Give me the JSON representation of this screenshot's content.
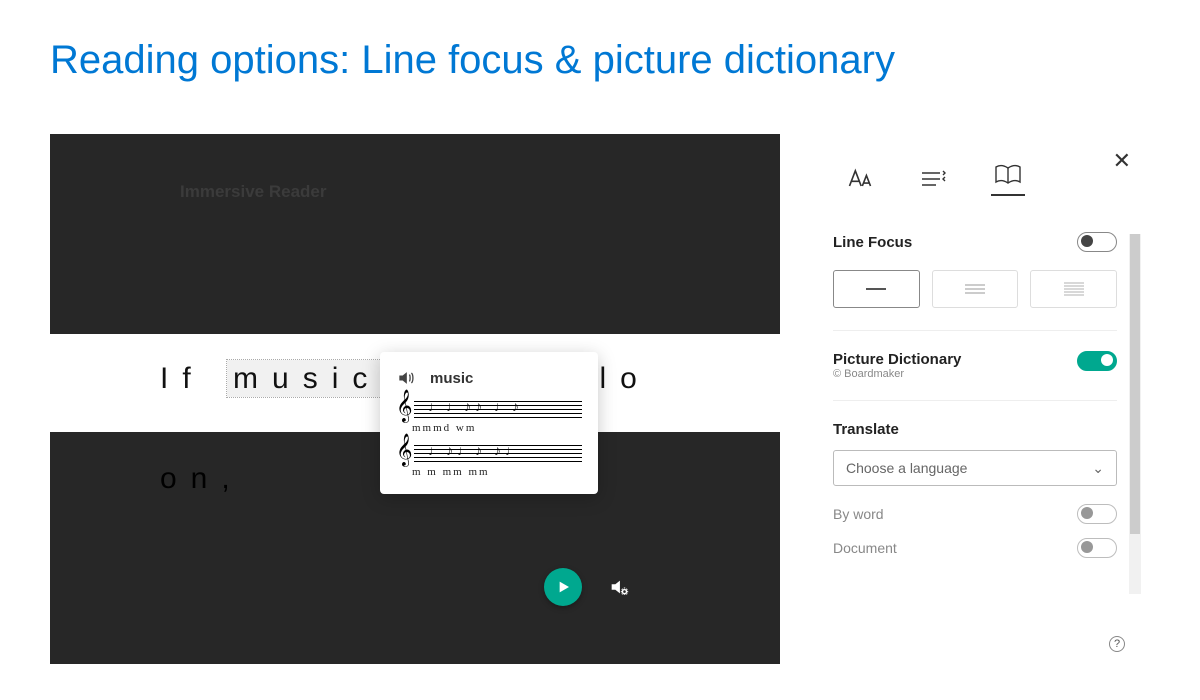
{
  "slide": {
    "title": "Reading options: Line focus & picture dictionary"
  },
  "reader": {
    "app_label": "Immersive Reader",
    "line1_pre": "If ",
    "line1_highlight": "music",
    "line1_post": " ood of lo",
    "line2": "on,"
  },
  "popup": {
    "word": "music",
    "lyric1": "mmmd wm",
    "lyric2": "m m mm  mm"
  },
  "panel": {
    "line_focus_label": "Line Focus",
    "picture_dict_label": "Picture Dictionary",
    "picture_dict_copy": "© Boardmaker",
    "translate_label": "Translate",
    "language_placeholder": "Choose a language",
    "by_word_label": "By word",
    "document_label": "Document",
    "help_symbol": "?"
  },
  "icons": {
    "close": "✕",
    "chevron_down": "⌄"
  }
}
